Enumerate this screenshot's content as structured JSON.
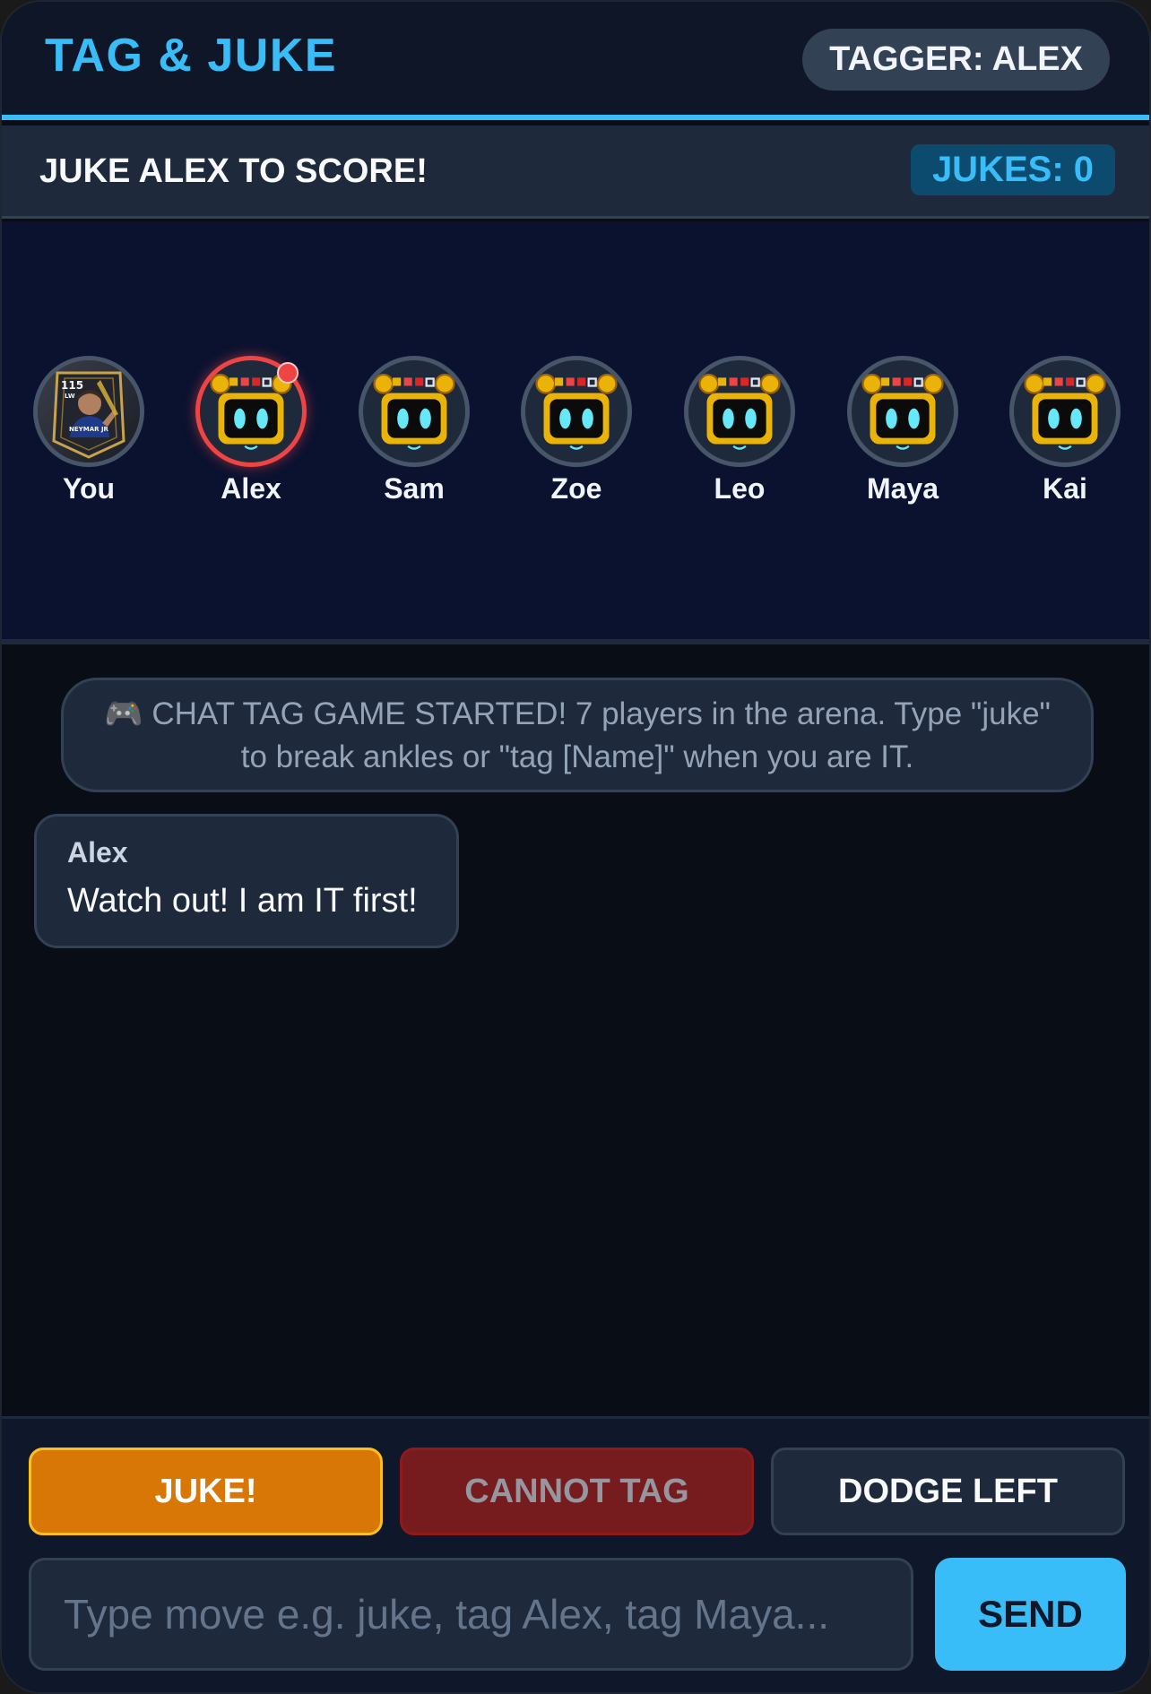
{
  "header": {
    "title": "TAG & JUKE",
    "tagger_badge": "TAGGER: ALEX"
  },
  "status": {
    "objective": "JUKE ALEX TO SCORE!",
    "jukes": "JUKES: 0"
  },
  "players": [
    {
      "name": "You",
      "avatar": "player-card",
      "is_tagger": false
    },
    {
      "name": "Alex",
      "avatar": "robot-icon",
      "is_tagger": true
    },
    {
      "name": "Sam",
      "avatar": "robot-icon",
      "is_tagger": false
    },
    {
      "name": "Zoe",
      "avatar": "robot-icon",
      "is_tagger": false
    },
    {
      "name": "Leo",
      "avatar": "robot-icon",
      "is_tagger": false
    },
    {
      "name": "Maya",
      "avatar": "robot-icon",
      "is_tagger": false
    },
    {
      "name": "Kai",
      "avatar": "robot-icon",
      "is_tagger": false
    }
  ],
  "player_card": {
    "rating": "115",
    "position": "LW",
    "name": "NEYMAR JR"
  },
  "chat": {
    "system_message": "🎮 CHAT TAG GAME STARTED! 7 players in the arena. Type \"juke\" to break ankles or \"tag [Name]\" when you are IT.",
    "messages": [
      {
        "sender": "Alex",
        "text": "Watch out! I am IT first!"
      }
    ]
  },
  "actions": {
    "juke": "JUKE!",
    "tag": "CANNOT TAG",
    "dodge": "DODGE LEFT"
  },
  "input": {
    "placeholder": "Type move e.g. juke, tag Alex, tag Maya...",
    "send": "SEND"
  },
  "colors": {
    "accent": "#38bdf8",
    "tagger": "#ef4444",
    "juke": "#d97706",
    "background": "#090d16"
  }
}
